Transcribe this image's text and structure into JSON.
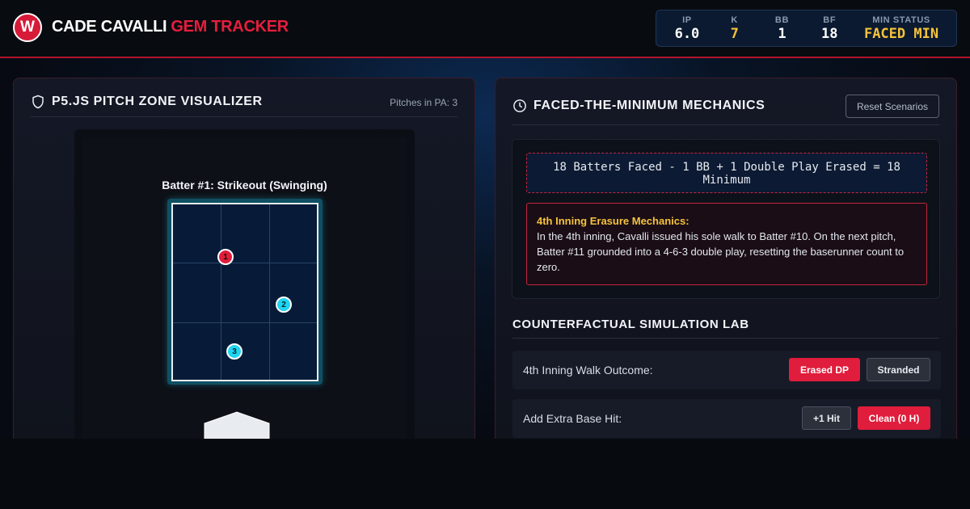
{
  "header": {
    "logo_letter": "W",
    "title_main": "CADE CAVALLI",
    "title_accent": "GEM TRACKER",
    "stats": [
      {
        "label": "IP",
        "value": "6.0"
      },
      {
        "label": "K",
        "value": "7"
      },
      {
        "label": "BB",
        "value": "1"
      },
      {
        "label": "BF",
        "value": "18"
      },
      {
        "label": "MIN STATUS",
        "value": "FACED MIN"
      }
    ]
  },
  "left_panel": {
    "title": "P5.JS PITCH ZONE VISUALIZER",
    "pitches_label": "Pitches in PA: 3",
    "batter_label": "Batter #1: Strikeout (Swinging)",
    "pitches": [
      {
        "number": "1",
        "color": "#e01d3c"
      },
      {
        "number": "2",
        "color": "#1fd5f0"
      },
      {
        "number": "3",
        "color": "#1fd5f0"
      }
    ]
  },
  "right_panel": {
    "title": "FACED-THE-MINIMUM MECHANICS",
    "reset_label": "Reset Scenarios",
    "formula": "18 Batters Faced - 1 BB + 1 Double Play Erased = 18 Minimum",
    "erasure_title": "4th Inning Erasure Mechanics:",
    "erasure_body": "In the 4th inning, Cavalli issued his sole walk to Batter #10. On the next pitch, Batter #11 grounded into a 4-6-3 double play, resetting the baserunner count to zero.",
    "sim_title": "COUNTERFACTUAL SIMULATION LAB",
    "sim_rows": [
      {
        "label": "4th Inning Walk Outcome:",
        "option_a": "Erased DP",
        "option_b": "Stranded",
        "active": "a"
      },
      {
        "label": "Add Extra Base Hit:",
        "option_a": "+1 Hit",
        "option_b": "Clean (0 H)",
        "active": "b"
      }
    ]
  },
  "colors": {
    "accent_red": "#e01d3c",
    "gold": "#f5c33b",
    "cyan": "#1fd5f0",
    "zone_navy": "#071b38"
  }
}
